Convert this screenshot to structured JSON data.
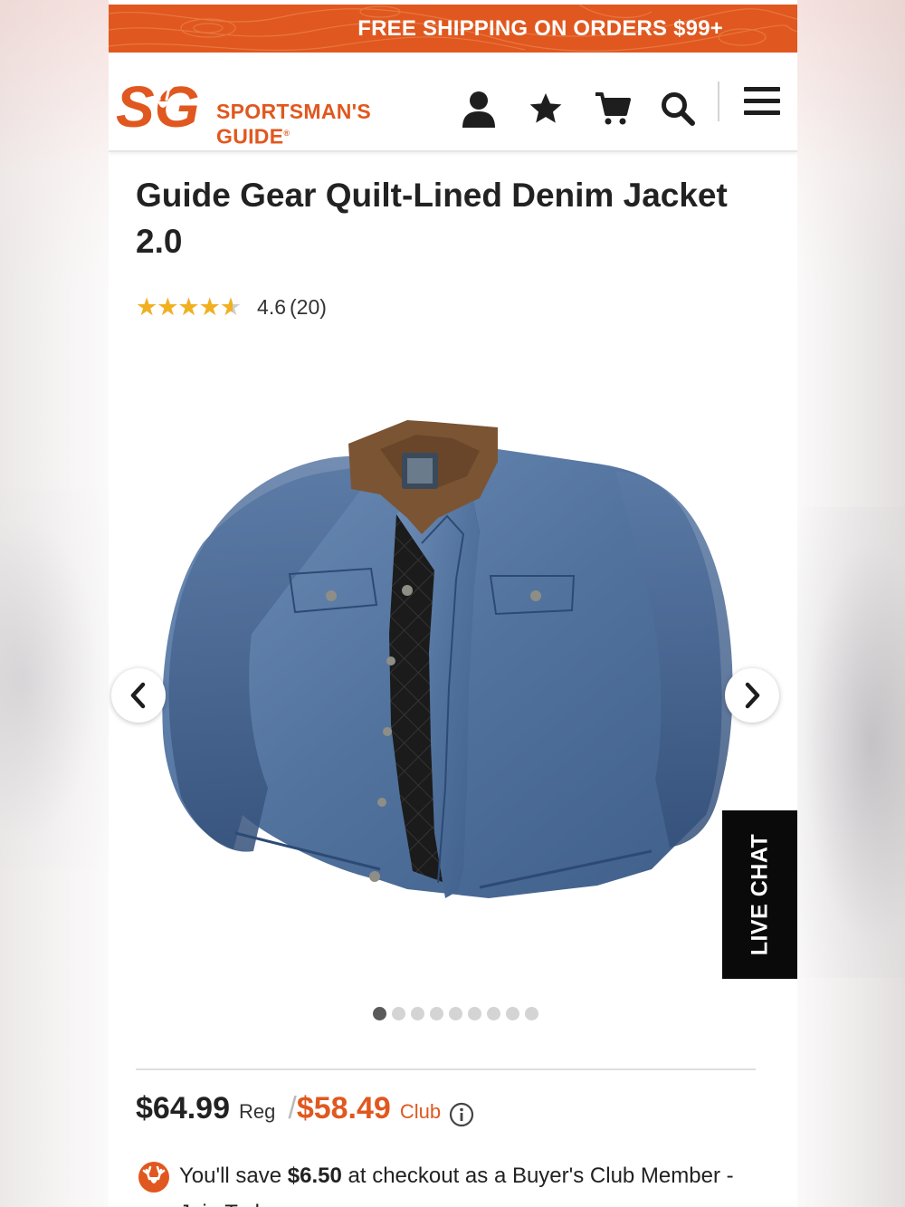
{
  "promo_banner": {
    "text": "FREE SHIPPING ON ORDERS $99+"
  },
  "brand": {
    "logo_monogram": "SG",
    "name_line1": "SPORTSMAN'S",
    "name_line2": "GUIDE",
    "registered_mark": "®"
  },
  "header_icons": [
    "account-icon",
    "favorites-star-icon",
    "cart-icon",
    "search-icon",
    "menu-icon"
  ],
  "product": {
    "title": "Guide Gear Quilt-Lined Denim Jacket 2.0",
    "rating_value": "4.6",
    "rating_fraction": 0.92,
    "review_count": "(20)",
    "stars": "★★★★★",
    "image_alt": "Blue denim jacket with brown corduroy collar and black quilted lining"
  },
  "gallery": {
    "total_images": 9,
    "active_index": 0
  },
  "live_chat": {
    "label": "LIVE CHAT"
  },
  "pricing": {
    "regular_price": "$64.99",
    "regular_label": "Reg",
    "separator": "/",
    "club_price": "$58.49",
    "club_label": "Club"
  },
  "savings": {
    "prefix": "You'll save ",
    "amount": "$6.50",
    "suffix": " at checkout as a Buyer's Club Member - Join Today"
  },
  "colors": {
    "brand_orange": "#e0581f",
    "star_gold": "#f2b01e",
    "text_dark": "#222222",
    "live_chat_bg": "#0a0a0a"
  }
}
